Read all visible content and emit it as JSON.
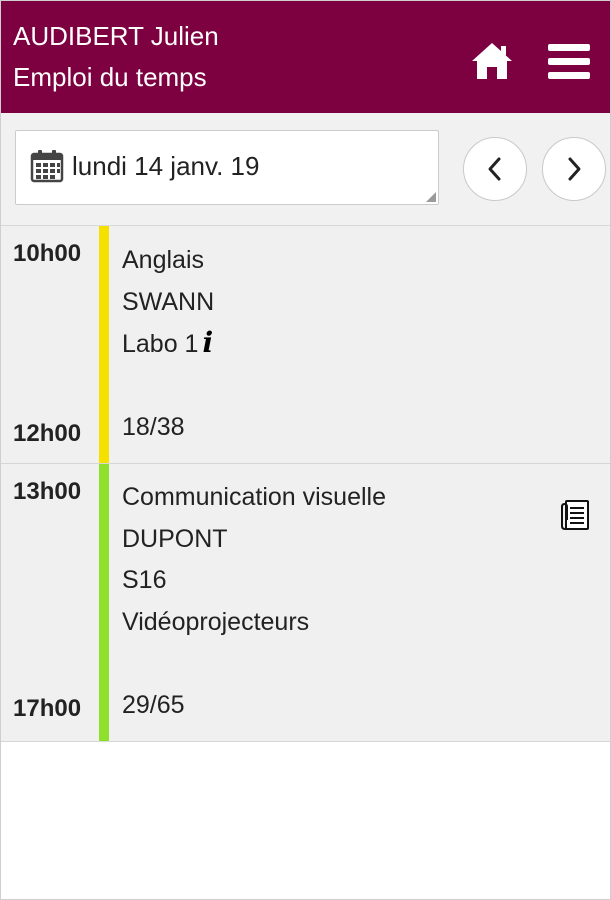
{
  "header": {
    "user_name": "AUDIBERT Julien",
    "subtitle": "Emploi du temps",
    "home_icon": "home-icon",
    "menu_icon": "menu-icon"
  },
  "toolbar": {
    "date": "lundi 14 janv. 19",
    "calendar_icon": "calendar-icon",
    "prev_icon": "chevron-left-icon",
    "next_icon": "chevron-right-icon"
  },
  "courses": [
    {
      "start": "10h00",
      "end": "12h00",
      "subject": "Anglais",
      "teacher": "SWANN",
      "room": "Labo 1",
      "room_info_icon": "i",
      "count": "18/38",
      "color": "#f5e000"
    },
    {
      "start": "13h00",
      "end": "17h00",
      "subject": "Communication visuelle",
      "teacher": "DUPONT",
      "room": "S16",
      "equipment": "Vidéoprojecteurs",
      "count": "29/65",
      "color": "#8ee02a",
      "attachment_icon": "document-icon"
    }
  ],
  "colors": {
    "header_bg": "#7d0040",
    "body_bg": "#f0f0f0"
  }
}
